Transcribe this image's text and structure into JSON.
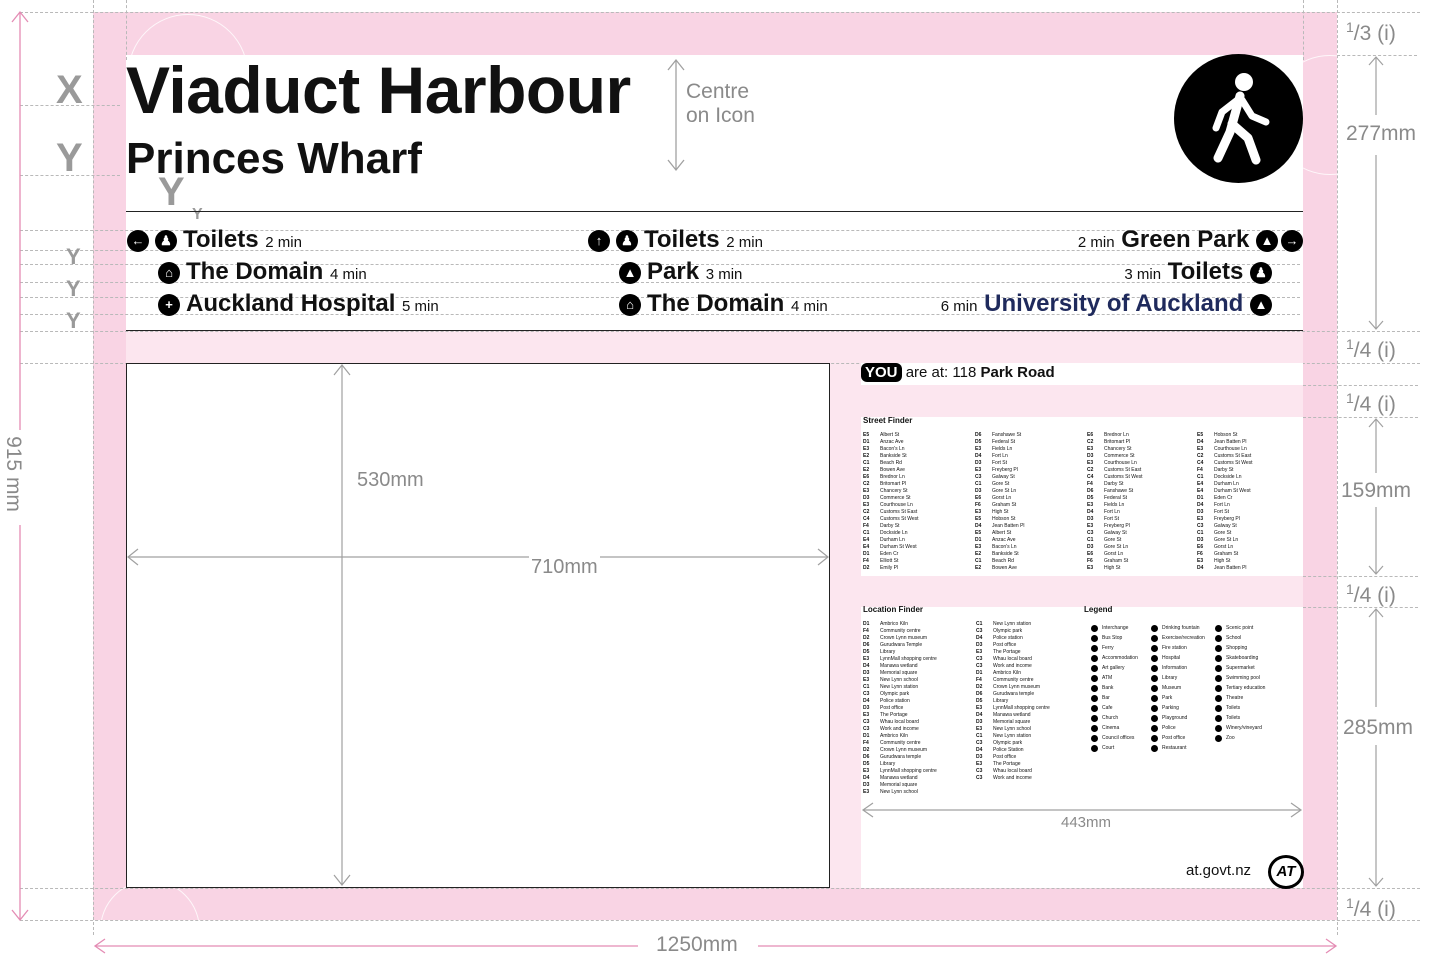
{
  "sign": {
    "title": "Viaduct Harbour",
    "subtitle": "Princes Wharf",
    "centre_note_1": "Centre",
    "centre_note_2": "on Icon",
    "pedestrian_icon": "walking-person-icon"
  },
  "wayfinding": {
    "left": [
      {
        "arrow": "arrow-left-icon",
        "icon": "toilets-icon",
        "name": "Toilets",
        "time": "2 min"
      },
      {
        "icon": "museum-icon",
        "name": "The Domain",
        "time": "4 min"
      },
      {
        "icon": "hospital-icon",
        "name": "Auckland Hospital",
        "time": "5 min"
      }
    ],
    "center": [
      {
        "arrow": "arrow-up-icon",
        "icon": "toilets-icon",
        "name": "Toilets",
        "time": "2 min"
      },
      {
        "icon": "park-icon",
        "name": "Park",
        "time": "3 min"
      },
      {
        "icon": "museum-icon",
        "name": "The Domain",
        "time": "4 min"
      }
    ],
    "right": [
      {
        "arrow": "arrow-right-icon",
        "icon": "park-icon",
        "name": "Green Park",
        "time": "2 min"
      },
      {
        "icon": "toilets-icon",
        "name": "Toilets",
        "time": "3 min"
      },
      {
        "icon": "university-icon",
        "name": "University of Auckland",
        "time": "6 min"
      }
    ]
  },
  "map_panel": {
    "height_label": "530mm",
    "width_label": "710mm"
  },
  "you_are_at": {
    "badge": "YOU",
    "text": "are at: 118",
    "place": "Park Road"
  },
  "street_finder": {
    "title": "Street Finder",
    "columns": [
      [
        [
          "E5",
          "Albert St"
        ],
        [
          "D1",
          "Anzac Ave"
        ],
        [
          "E3",
          "Bacon's Ln"
        ],
        [
          "E2",
          "Bankside St"
        ],
        [
          "C1",
          "Beach Rd"
        ],
        [
          "E2",
          "Bowen Ave"
        ],
        [
          "E6",
          "Brednor Ln"
        ],
        [
          "C2",
          "Britomart Pl"
        ],
        [
          "E3",
          "Chancery St"
        ],
        [
          "D3",
          "Commerce St"
        ],
        [
          "E3",
          "Courthouse Ln"
        ],
        [
          "C2",
          "Customs St East"
        ],
        [
          "C4",
          "Customs St West"
        ],
        [
          "F4",
          "Darby St"
        ],
        [
          "C1",
          "Dockside Ln"
        ],
        [
          "E4",
          "Durham Ln"
        ],
        [
          "E4",
          "Durham St West"
        ],
        [
          "D1",
          "Eden Cr"
        ],
        [
          "F4",
          "Elliott St"
        ],
        [
          "D2",
          "Emily Pl"
        ]
      ],
      [
        [
          "D6",
          "Fanshawe St"
        ],
        [
          "D5",
          "Federal St"
        ],
        [
          "E3",
          "Fields Ln"
        ],
        [
          "D4",
          "Fort Ln"
        ],
        [
          "D3",
          "Fort St"
        ],
        [
          "E3",
          "Freyberg Pl"
        ],
        [
          "C3",
          "Galway St"
        ],
        [
          "C1",
          "Gore St"
        ],
        [
          "D3",
          "Gore St Ln"
        ],
        [
          "E6",
          "Gorst Ln"
        ],
        [
          "F6",
          "Graham St"
        ],
        [
          "E3",
          "High St"
        ],
        [
          "E5",
          "Hobson St"
        ],
        [
          "D4",
          "Jean Batten Pl"
        ],
        [
          "E5",
          "Albert St"
        ],
        [
          "D1",
          "Anzac Ave"
        ],
        [
          "E3",
          "Bacon's Ln"
        ],
        [
          "E2",
          "Bankside St"
        ],
        [
          "C1",
          "Beach Rd"
        ],
        [
          "E2",
          "Bowen Ave"
        ]
      ],
      [
        [
          "E6",
          "Brednor Ln"
        ],
        [
          "C2",
          "Britomart Pl"
        ],
        [
          "E3",
          "Chancery St"
        ],
        [
          "D3",
          "Commerce St"
        ],
        [
          "E3",
          "Courthouse Ln"
        ],
        [
          "C2",
          "Customs St East"
        ],
        [
          "C4",
          "Customs St West"
        ],
        [
          "F4",
          "Darby St"
        ],
        [
          "D6",
          "Fanshawe St"
        ],
        [
          "D5",
          "Federal St"
        ],
        [
          "E3",
          "Fields Ln"
        ],
        [
          "D4",
          "Fort Ln"
        ],
        [
          "D3",
          "Fort St"
        ],
        [
          "E3",
          "Freyberg Pl"
        ],
        [
          "C3",
          "Galway St"
        ],
        [
          "C1",
          "Gore St"
        ],
        [
          "D3",
          "Gore St Ln"
        ],
        [
          "E6",
          "Gorst Ln"
        ],
        [
          "F6",
          "Graham St"
        ],
        [
          "E3",
          "High St"
        ]
      ],
      [
        [
          "E5",
          "Hobson St"
        ],
        [
          "D4",
          "Jean Batten Pl"
        ],
        [
          "E3",
          "Courthouse Ln"
        ],
        [
          "C2",
          "Customs St East"
        ],
        [
          "C4",
          "Customs St West"
        ],
        [
          "F4",
          "Darby St"
        ],
        [
          "C1",
          "Dockside Ln"
        ],
        [
          "E4",
          "Durham Ln"
        ],
        [
          "E4",
          "Durham St West"
        ],
        [
          "D1",
          "Eden Cr"
        ],
        [
          "D4",
          "Fort Ln"
        ],
        [
          "D3",
          "Fort St"
        ],
        [
          "E3",
          "Freyberg Pl"
        ],
        [
          "C3",
          "Galway St"
        ],
        [
          "C1",
          "Gore St"
        ],
        [
          "D3",
          "Gore St Ln"
        ],
        [
          "E6",
          "Gorst Ln"
        ],
        [
          "F6",
          "Graham St"
        ],
        [
          "E3",
          "High St"
        ],
        [
          "D4",
          "Jean Batten Pl"
        ]
      ]
    ]
  },
  "location_finder": {
    "title": "Location Finder",
    "columns": [
      [
        [
          "D1",
          "Ambrico Kiln"
        ],
        [
          "F4",
          "Community centre"
        ],
        [
          "D2",
          "Crown Lynn museum"
        ],
        [
          "D6",
          "Gurudwara Temple"
        ],
        [
          "D5",
          "Library"
        ],
        [
          "E3",
          "LynnMall shopping centre"
        ],
        [
          "D4",
          "Manawa wetland"
        ],
        [
          "D3",
          "Memorial square"
        ],
        [
          "E3",
          "New Lynn school"
        ],
        [
          "C1",
          "New Lynn station"
        ],
        [
          "C3",
          "Olympic park"
        ],
        [
          "D4",
          "Police station"
        ],
        [
          "D3",
          "Post office"
        ],
        [
          "E3",
          "The Portage"
        ],
        [
          "C3",
          "Whau local board"
        ],
        [
          "C3",
          "Work and income"
        ],
        [
          "D1",
          "Ambrico Kiln"
        ],
        [
          "F4",
          "Community centre"
        ],
        [
          "D2",
          "Crown Lynn museum"
        ],
        [
          "D6",
          "Gurudwara temple"
        ],
        [
          "D5",
          "Library"
        ],
        [
          "E3",
          "LynnMall shopping centre"
        ],
        [
          "D4",
          "Manawa wetland"
        ],
        [
          "D3",
          "Memorial square"
        ],
        [
          "E3",
          "New Lynn school"
        ]
      ],
      [
        [
          "C1",
          "New Lynn station"
        ],
        [
          "C3",
          "Olympic park"
        ],
        [
          "D4",
          "Police station"
        ],
        [
          "D3",
          "Post office"
        ],
        [
          "E3",
          "The Portage"
        ],
        [
          "C3",
          "Whau local board"
        ],
        [
          "C3",
          "Work and income"
        ],
        [
          "D1",
          "Ambrico Kiln"
        ],
        [
          "F4",
          "Community centre"
        ],
        [
          "D2",
          "Crown Lynn museum"
        ],
        [
          "D6",
          "Gurudwara temple"
        ],
        [
          "D5",
          "Library"
        ],
        [
          "E3",
          "LynnMall shopping centre"
        ],
        [
          "D4",
          "Manawa wetland"
        ],
        [
          "D3",
          "Memorial square"
        ],
        [
          "E3",
          "New Lynn school"
        ],
        [
          "C1",
          "New Lynn station"
        ],
        [
          "C3",
          "Olympic park"
        ],
        [
          "D4",
          "Police Station"
        ],
        [
          "D3",
          "Post office"
        ],
        [
          "E3",
          "The Portage"
        ],
        [
          "C3",
          "Whau local board"
        ],
        [
          "C3",
          "Work and income"
        ]
      ]
    ]
  },
  "legend": {
    "title": "Legend",
    "columns": [
      [
        "Interchange",
        "Bus Stop",
        "Ferry",
        "Accommodation",
        "Art gallery",
        "ATM",
        "Bank",
        "Bar",
        "Cafe",
        "Church",
        "Cinema",
        "Council offices",
        "Court"
      ],
      [
        "Drinking fountain",
        "Exercise/recreation",
        "Fire station",
        "Hospital",
        "Information",
        "Library",
        "Museum",
        "Park",
        "Parking",
        "Playground",
        "Police",
        "Post office",
        "Restaurant"
      ],
      [
        "Scenic point",
        "School",
        "Shopping",
        "Skateboarding",
        "Supermarket",
        "Swimming pool",
        "Tertiary education",
        "Theatre",
        "Toilets",
        "Toilets",
        "Winery/vineyard",
        "Zoo"
      ]
    ]
  },
  "footer": {
    "url": "at.govt.nz",
    "logo_text": "AT"
  },
  "dimensions": {
    "total_width": "1250mm",
    "total_height": "915 mm",
    "header_height": "277mm",
    "street_finder_height": "159mm",
    "location_finder_height": "285mm",
    "info_width": "443mm",
    "frac_top": "3 (i)",
    "frac_quarter": "4 (i)",
    "frac_num": "1"
  },
  "guide_letters": {
    "x": "X",
    "y": "Y"
  },
  "colors": {
    "guide_pink": "#f9d4e4",
    "dimension_pink": "#e48cb4",
    "ink": "#111111",
    "uni_blue": "#1f2a5c"
  }
}
